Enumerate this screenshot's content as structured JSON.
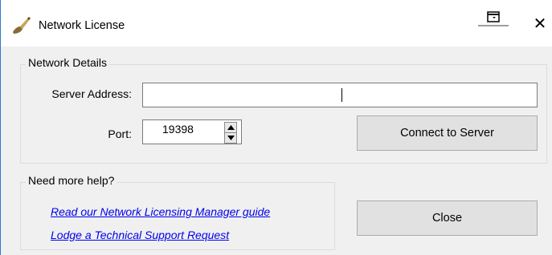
{
  "window": {
    "title": "Network License",
    "icons": {
      "app": "brush-icon",
      "restore": "restore-window-icon",
      "close": "close-icon"
    },
    "close_glyph": "✕"
  },
  "network_details": {
    "group_label": "Network Details",
    "server_address_label": "Server Address:",
    "server_address_value": "",
    "port_label": "Port:",
    "port_value": "19398",
    "connect_label": "Connect to Server"
  },
  "help": {
    "group_label": "Need more help?",
    "links": [
      "Read our Network Licensing Manager guide",
      "Lodge a Technical Support Request"
    ]
  },
  "close_button_label": "Close",
  "colors": {
    "link": "#0000ee",
    "button_bg": "#e1e1e1",
    "window_bg": "#f0f0f0"
  }
}
